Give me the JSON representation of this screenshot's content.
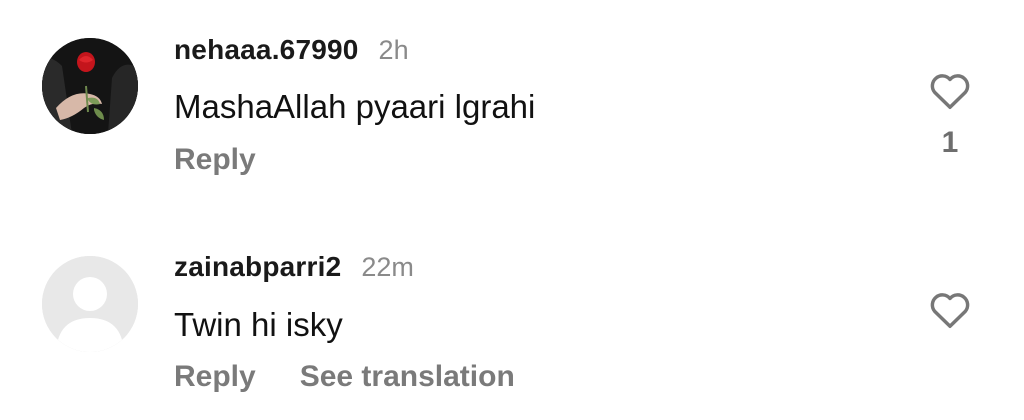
{
  "comments": [
    {
      "username": "nehaaa.67990",
      "timestamp": "2h",
      "text": "MashaAllah pyaari lgrahi",
      "actions": {
        "reply": "Reply"
      },
      "like_count": "1",
      "avatar": "rose-photo"
    },
    {
      "username": "zainabparri2",
      "timestamp": "22m",
      "text": "Twin hi isky",
      "actions": {
        "reply": "Reply",
        "see_translation": "See translation"
      },
      "avatar": "default-person"
    }
  ],
  "icons": {
    "like": "heart-outline-icon"
  },
  "colors": {
    "username": "#1a1a1a",
    "secondary_text": "#8a8a8a",
    "action_text": "#7a7a7a",
    "heart_stroke": "#777777"
  }
}
